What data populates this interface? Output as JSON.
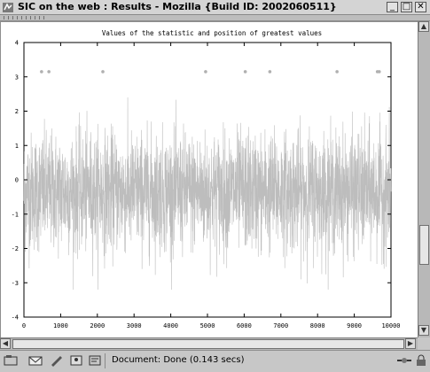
{
  "window": {
    "title": "SIC on the web : Results - Mozilla {Build ID: 2002060511}",
    "buttons": {
      "minimize": "_",
      "maximize": "□",
      "close": "✕"
    }
  },
  "statusbar": {
    "text": "Document: Done (0.143 secs)",
    "icons": [
      "navigator-icon",
      "mail-icon",
      "composer-icon",
      "address-book-icon",
      "chat-icon"
    ]
  },
  "chart_data": {
    "type": "line",
    "title": "Values of the statistic and position of greatest values",
    "xlim": [
      0,
      10000
    ],
    "ylim": [
      -4,
      4
    ],
    "x_ticks": [
      0,
      1000,
      2000,
      3000,
      4000,
      5000,
      6000,
      7000,
      8000,
      9000,
      10000
    ],
    "y_ticks": [
      -4,
      -3,
      -2,
      -1,
      0,
      1,
      2,
      3,
      4
    ],
    "series": [
      {
        "kind": "noise-line",
        "n_points": 10000,
        "approx_range": [
          -3.2,
          2.4
        ],
        "color": "#bdbdbd"
      },
      {
        "kind": "markers",
        "y": 3.15,
        "x": [
          480,
          680,
          2150,
          4950,
          6030,
          6700,
          8530,
          9630,
          9680
        ],
        "color": "#b0b0b0"
      }
    ],
    "grid": false
  }
}
